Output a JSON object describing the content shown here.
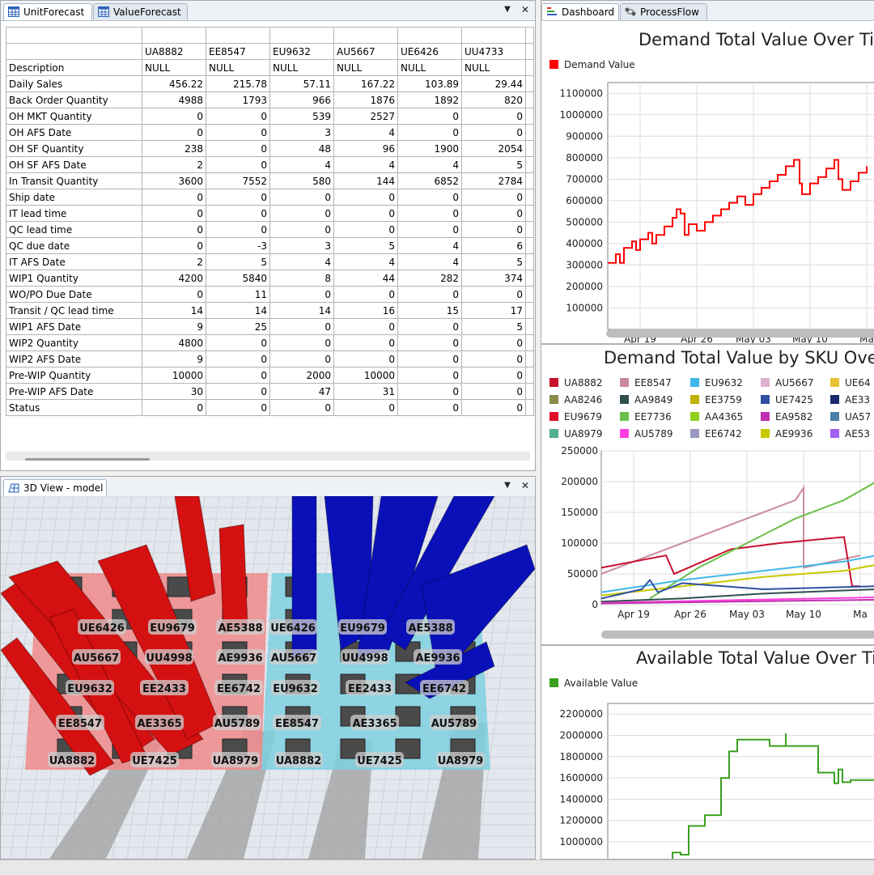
{
  "tabs": {
    "unit_forecast": "UnitForecast",
    "value_forecast": "ValueForecast",
    "dashboard": "Dashboard",
    "process_flow": "ProcessFlow",
    "view3d": "3D View - model"
  },
  "controls": {
    "dropdown": "▼",
    "close": "✕"
  },
  "grid": {
    "columns": [
      "UA8882",
      "EE8547",
      "EU9632",
      "AU5667",
      "UE6426",
      "UU4733"
    ],
    "rows": [
      {
        "label": "Description",
        "cells": [
          "NULL",
          "NULL",
          "NULL",
          "NULL",
          "NULL",
          "NULL"
        ],
        "text": true
      },
      {
        "label": "Daily Sales",
        "cells": [
          "456.22",
          "215.78",
          "57.11",
          "167.22",
          "103.89",
          "29.44"
        ]
      },
      {
        "label": "Back Order Quantity",
        "cells": [
          "4988",
          "1793",
          "966",
          "1876",
          "1892",
          "820"
        ]
      },
      {
        "label": "OH MKT Quantity",
        "cells": [
          "0",
          "0",
          "539",
          "2527",
          "0",
          "0"
        ]
      },
      {
        "label": "OH AFS Date",
        "cells": [
          "0",
          "0",
          "3",
          "4",
          "0",
          "0"
        ]
      },
      {
        "label": "OH SF Quantity",
        "cells": [
          "238",
          "0",
          "48",
          "96",
          "1900",
          "2054"
        ]
      },
      {
        "label": "OH SF AFS Date",
        "cells": [
          "2",
          "0",
          "4",
          "4",
          "4",
          "5"
        ]
      },
      {
        "label": "In Transit Quantity",
        "cells": [
          "3600",
          "7552",
          "580",
          "144",
          "6852",
          "2784"
        ]
      },
      {
        "label": "Ship date",
        "cells": [
          "0",
          "0",
          "0",
          "0",
          "0",
          "0"
        ]
      },
      {
        "label": "IT lead time",
        "cells": [
          "0",
          "0",
          "0",
          "0",
          "0",
          "0"
        ]
      },
      {
        "label": "QC lead time",
        "cells": [
          "0",
          "0",
          "0",
          "0",
          "0",
          "0"
        ]
      },
      {
        "label": "QC due date",
        "cells": [
          "0",
          "-3",
          "3",
          "5",
          "4",
          "6"
        ]
      },
      {
        "label": "IT AFS Date",
        "cells": [
          "2",
          "5",
          "4",
          "4",
          "4",
          "5"
        ]
      },
      {
        "label": "WIP1 Quantity",
        "cells": [
          "4200",
          "5840",
          "8",
          "44",
          "282",
          "374"
        ]
      },
      {
        "label": "WO/PO Due Date",
        "cells": [
          "0",
          "11",
          "0",
          "0",
          "0",
          "0"
        ]
      },
      {
        "label": "Transit / QC lead time",
        "cells": [
          "14",
          "14",
          "14",
          "16",
          "15",
          "17"
        ]
      },
      {
        "label": "WIP1 AFS Date",
        "cells": [
          "9",
          "25",
          "0",
          "0",
          "0",
          "5"
        ]
      },
      {
        "label": "WIP2 Quantity",
        "cells": [
          "4800",
          "0",
          "0",
          "0",
          "0",
          "0"
        ]
      },
      {
        "label": "WIP2 AFS Date",
        "cells": [
          "9",
          "0",
          "0",
          "0",
          "0",
          "0"
        ]
      },
      {
        "label": "Pre-WIP Quantity",
        "cells": [
          "10000",
          "0",
          "2000",
          "10000",
          "0",
          "0"
        ]
      },
      {
        "label": "Pre-WIP AFS Date",
        "cells": [
          "30",
          "0",
          "47",
          "31",
          "0",
          "0"
        ]
      },
      {
        "label": "Status",
        "cells": [
          "0",
          "0",
          "0",
          "0",
          "0",
          "0"
        ]
      }
    ]
  },
  "view3d": {
    "labels_left": [
      {
        "text": "UE6426"
      },
      {
        "text": "EU9679"
      },
      {
        "text": "AE5388"
      },
      {
        "text": "AU5667"
      },
      {
        "text": "UU4998"
      },
      {
        "text": "AE9936"
      },
      {
        "text": "EU9632"
      },
      {
        "text": "EE2433"
      },
      {
        "text": "EE6742"
      },
      {
        "text": "EE8547"
      },
      {
        "text": "AE3365"
      },
      {
        "text": "AU5789"
      },
      {
        "text": "UA8882"
      },
      {
        "text": "UE7425"
      },
      {
        "text": "UA8979"
      }
    ],
    "labels_right": [
      {
        "text": "UE6426"
      },
      {
        "text": "EU9679"
      },
      {
        "text": "AE5388"
      },
      {
        "text": "AU5667"
      },
      {
        "text": "UU4998"
      },
      {
        "text": "AE9936"
      },
      {
        "text": "EU9632"
      },
      {
        "text": "EE2433"
      },
      {
        "text": "EE6742"
      },
      {
        "text": "EE8547"
      },
      {
        "text": "AE3365"
      },
      {
        "text": "AU5789"
      },
      {
        "text": "UA8882"
      },
      {
        "text": "UE7425"
      },
      {
        "text": "UA8979"
      }
    ],
    "colors": {
      "left": "#d41010",
      "right": "#0a10b8",
      "floor_left": "#f08a8a",
      "floor_right": "#7fd0e0"
    }
  },
  "chart_data": [
    {
      "type": "line",
      "title": "Demand Total Value Over Time",
      "legend": [
        {
          "name": "Demand Value",
          "color": "#ff0000"
        }
      ],
      "x_ticks": [
        "Apr 19",
        "Apr 26",
        "May 03",
        "May 10",
        "Ma"
      ],
      "y_ticks": [
        "1100000",
        "1000000",
        "900000",
        "800000",
        "700000",
        "600000",
        "500000",
        "400000",
        "300000",
        "200000",
        "100000"
      ],
      "ylim": [
        0,
        1150000
      ],
      "x_range_days": [
        0,
        34
      ],
      "series": [
        {
          "name": "Demand Value",
          "color": "#ff0000",
          "step": true,
          "points": [
            [
              0,
              310000
            ],
            [
              1,
              350000
            ],
            [
              1.5,
              310000
            ],
            [
              2,
              380000
            ],
            [
              3,
              410000
            ],
            [
              3.5,
              370000
            ],
            [
              4,
              420000
            ],
            [
              5,
              450000
            ],
            [
              5.5,
              400000
            ],
            [
              6,
              440000
            ],
            [
              7,
              480000
            ],
            [
              8,
              520000
            ],
            [
              8.5,
              560000
            ],
            [
              9,
              540000
            ],
            [
              9.5,
              440000
            ],
            [
              10,
              490000
            ],
            [
              11,
              460000
            ],
            [
              12,
              500000
            ],
            [
              13,
              530000
            ],
            [
              14,
              560000
            ],
            [
              15,
              590000
            ],
            [
              16,
              620000
            ],
            [
              17,
              580000
            ],
            [
              18,
              630000
            ],
            [
              19,
              660000
            ],
            [
              20,
              690000
            ],
            [
              21,
              720000
            ],
            [
              22,
              760000
            ],
            [
              23,
              790000
            ],
            [
              23.7,
              680000
            ],
            [
              24,
              630000
            ],
            [
              25,
              680000
            ],
            [
              26,
              710000
            ],
            [
              27,
              750000
            ],
            [
              28,
              790000
            ],
            [
              28.5,
              700000
            ],
            [
              29,
              650000
            ],
            [
              30,
              690000
            ],
            [
              31,
              730000
            ],
            [
              32,
              760000
            ]
          ]
        }
      ]
    },
    {
      "type": "line",
      "title": "Demand Total Value by SKU Over Time",
      "legend": [
        {
          "name": "UA8882",
          "color": "#c8102e"
        },
        {
          "name": "EE8547",
          "color": "#c98a9e"
        },
        {
          "name": "EU9632",
          "color": "#3fb6e8"
        },
        {
          "name": "AU5667",
          "color": "#e0b0d0"
        },
        {
          "name": "UE64",
          "color": "#e8c030"
        },
        {
          "name": "AA8246",
          "color": "#8b8b4b"
        },
        {
          "name": "AA9849",
          "color": "#2f4f4f"
        },
        {
          "name": "EE3759",
          "color": "#c0b000"
        },
        {
          "name": "UE7425",
          "color": "#3050a0"
        },
        {
          "name": "AE33",
          "color": "#1a2a70"
        },
        {
          "name": "EU9679",
          "color": "#e0102a"
        },
        {
          "name": "EE7736",
          "color": "#6cc04a"
        },
        {
          "name": "AA4365",
          "color": "#90d020"
        },
        {
          "name": "EA9582",
          "color": "#c030b0"
        },
        {
          "name": "UA57",
          "color": "#4a80a8"
        },
        {
          "name": "UA8979",
          "color": "#50b090"
        },
        {
          "name": "AU5789",
          "color": "#ff40e0"
        },
        {
          "name": "EE6742",
          "color": "#9898c0"
        },
        {
          "name": "AE9936",
          "color": "#c8c800"
        },
        {
          "name": "AE53",
          "color": "#a060f0"
        }
      ],
      "x_ticks": [
        "Apr 19",
        "Apr 26",
        "May 03",
        "May 10",
        "Ma"
      ],
      "y_ticks": [
        "250000",
        "200000",
        "150000",
        "100000",
        "50000",
        "0"
      ],
      "ylim": [
        0,
        250000
      ],
      "x_range_days": [
        0,
        34
      ],
      "series": [
        {
          "name": "EE8547",
          "color": "#c98a9e",
          "points": [
            [
              0,
              50000
            ],
            [
              6,
              80000
            ],
            [
              12,
              110000
            ],
            [
              18,
              140000
            ],
            [
              24,
              170000
            ],
            [
              25,
              190000
            ],
            [
              25,
              60000
            ],
            [
              32,
              80000
            ]
          ]
        },
        {
          "name": "UA8882",
          "color": "#c8102e",
          "points": [
            [
              0,
              60000
            ],
            [
              4,
              70000
            ],
            [
              8,
              80000
            ],
            [
              9,
              50000
            ],
            [
              16,
              90000
            ],
            [
              22,
              100000
            ],
            [
              30,
              110000
            ],
            [
              31,
              30000
            ],
            [
              32,
              30000
            ]
          ]
        },
        {
          "name": "EE7736",
          "color": "#6cc04a",
          "points": [
            [
              6,
              10000
            ],
            [
              12,
              60000
            ],
            [
              18,
              100000
            ],
            [
              24,
              140000
            ],
            [
              30,
              170000
            ],
            [
              34,
              200000
            ]
          ]
        },
        {
          "name": "EU9632",
          "color": "#3fb6e8",
          "points": [
            [
              0,
              20000
            ],
            [
              10,
              40000
            ],
            [
              20,
              55000
            ],
            [
              30,
              70000
            ],
            [
              34,
              80000
            ]
          ]
        },
        {
          "name": "AE9936",
          "color": "#c8c800",
          "points": [
            [
              0,
              15000
            ],
            [
              10,
              30000
            ],
            [
              20,
              45000
            ],
            [
              30,
              55000
            ],
            [
              34,
              65000
            ]
          ]
        },
        {
          "name": "UE7425",
          "color": "#3050a0",
          "points": [
            [
              0,
              10000
            ],
            [
              5,
              25000
            ],
            [
              6,
              40000
            ],
            [
              7,
              20000
            ],
            [
              10,
              35000
            ],
            [
              20,
              25000
            ],
            [
              34,
              30000
            ]
          ]
        },
        {
          "name": "AA9849",
          "color": "#2f4f4f",
          "points": [
            [
              0,
              5000
            ],
            [
              10,
              10000
            ],
            [
              20,
              18000
            ],
            [
              34,
              25000
            ]
          ]
        },
        {
          "name": "AU5789",
          "color": "#ff40e0",
          "points": [
            [
              0,
              3000
            ],
            [
              34,
              12000
            ]
          ]
        },
        {
          "name": "EA9582",
          "color": "#c030b0",
          "points": [
            [
              0,
              2000
            ],
            [
              34,
              8000
            ]
          ]
        }
      ]
    },
    {
      "type": "line",
      "title": "Available Total Value Over Time",
      "legend": [
        {
          "name": "Available Value",
          "color": "#3aa020"
        }
      ],
      "x_ticks": [],
      "y_ticks": [
        "2200000",
        "2000000",
        "1800000",
        "1600000",
        "1400000",
        "1200000",
        "1000000",
        "800000"
      ],
      "ylim": [
        780000,
        2300000
      ],
      "x_range_days": [
        0,
        34
      ],
      "series": [
        {
          "name": "Available Value",
          "color": "#3aa020",
          "step": true,
          "points": [
            [
              8,
              780000
            ],
            [
              8,
              900000
            ],
            [
              9,
              880000
            ],
            [
              10,
              1150000
            ],
            [
              12,
              1250000
            ],
            [
              14,
              1600000
            ],
            [
              15,
              1850000
            ],
            [
              16,
              1960000
            ],
            [
              20,
              1900000
            ],
            [
              22,
              2020000
            ],
            [
              22,
              1900000
            ],
            [
              26,
              1650000
            ],
            [
              28,
              1550000
            ],
            [
              28.5,
              1680000
            ],
            [
              29,
              1560000
            ],
            [
              30,
              1580000
            ],
            [
              34,
              1560000
            ]
          ]
        }
      ]
    }
  ]
}
